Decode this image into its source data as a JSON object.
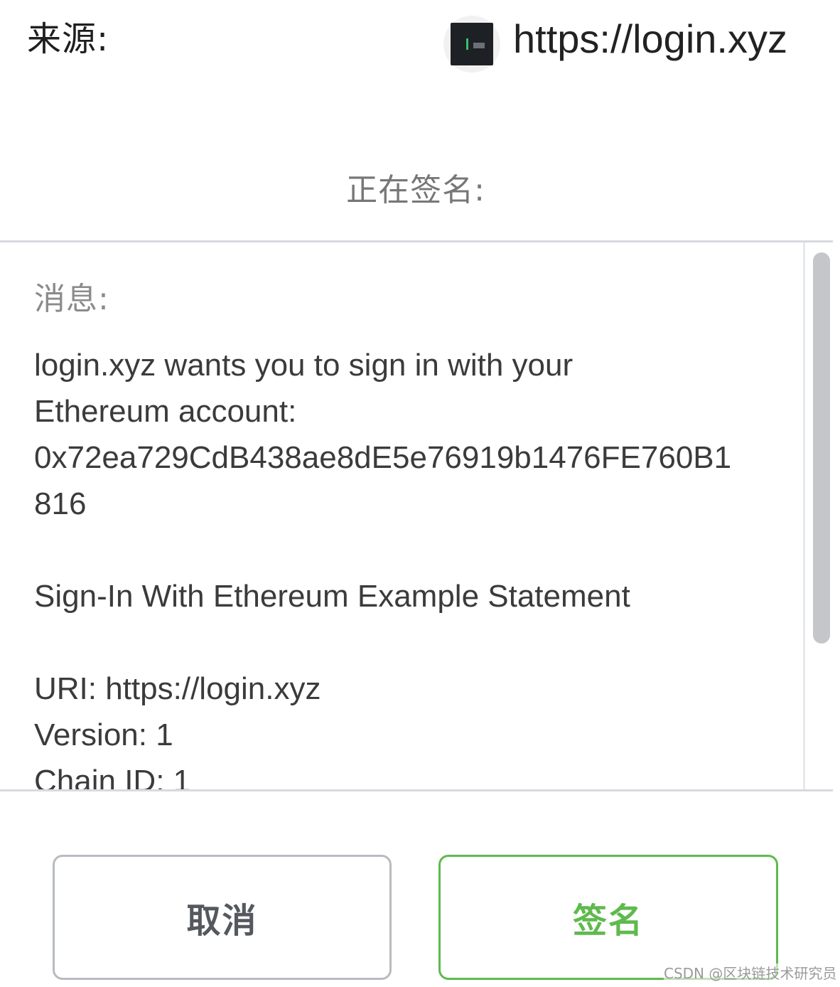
{
  "header": {
    "origin_label": "来源:",
    "site_icon": "site-favicon",
    "origin_url": "https://login.xyz"
  },
  "signing": {
    "label": "正在签名:"
  },
  "message": {
    "title": "消息:",
    "lines": [
      "login.xyz wants you to sign in with your",
      "Ethereum account:",
      "0x72ea729CdB438ae8dE5e76919b1476FE760B1",
      "816",
      "",
      "Sign-In With Ethereum Example Statement",
      "",
      "URI: https://login.xyz",
      "Version: 1",
      "Chain ID: 1"
    ]
  },
  "actions": {
    "cancel_label": "取消",
    "sign_label": "签名",
    "sign_color": "#5fba4d",
    "cancel_border_color": "#b8bbbf"
  },
  "watermark": {
    "text": "CSDN @区块链技术研究员"
  }
}
